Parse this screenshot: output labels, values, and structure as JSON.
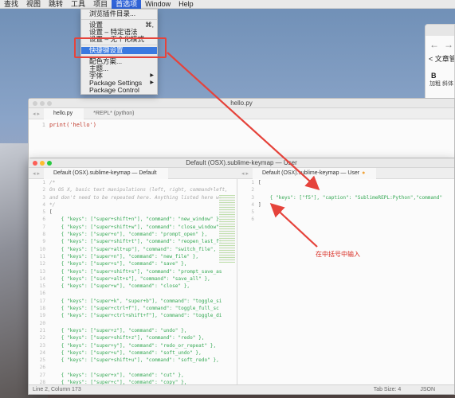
{
  "menubar": {
    "items": [
      "查找",
      "视图",
      "跳转",
      "工具",
      "项目",
      "首选项",
      "Window",
      "Help"
    ],
    "active_index": 5
  },
  "dropdown": {
    "items": [
      {
        "label": "浏览插件目录...",
        "shortcut": ""
      },
      {
        "label": "设置",
        "shortcut": "⌘,"
      },
      {
        "label": "设置 – 特定语法",
        "shortcut": ""
      },
      {
        "label": "设置 – 无个化模式",
        "shortcut": ""
      },
      {
        "label": "快捷键设置",
        "shortcut": ""
      },
      {
        "label": "配色方案...",
        "shortcut": ""
      },
      {
        "label": "主题...",
        "shortcut": ""
      },
      {
        "label": "字体",
        "shortcut": "▶"
      },
      {
        "label": "Package Settings",
        "shortcut": "▶"
      },
      {
        "label": "Package Control",
        "shortcut": ""
      }
    ],
    "highlight_index": 4
  },
  "annotation": {
    "text": "在中括号中输入",
    "color": "#d82a20"
  },
  "right_window": {
    "title": "< 文章管",
    "tool_a": "B",
    "tool_b": "加粗",
    "tool_c": "斜体"
  },
  "win1": {
    "title": "hello.py",
    "tabs": [
      "hello.py",
      "*REPL* (python)"
    ],
    "line_numbers": [
      "1"
    ],
    "code": "print('hello')"
  },
  "win2": {
    "title": "Default (OSX).sublime-keymap — User",
    "left_tab": "Default (OSX).sublime-keymap — Default",
    "right_tab": "Default (OSX).sublime-keymap — User",
    "left_gutter": [
      "1",
      "2",
      "3",
      "4",
      "5",
      "6",
      "7",
      "8",
      "9",
      "10",
      "11",
      "12",
      "13",
      "14",
      "15",
      "16",
      "17",
      "18",
      "19",
      "20",
      "21",
      "22",
      "23",
      "24",
      "25",
      "26",
      "27",
      "28"
    ],
    "left_lines": [
      "/*",
      "On OS X, basic text manipulations (left, right, command+left,",
      "and don't need to be repeated here. Anything listed here wi",
      "*/",
      "[",
      "    { \"keys\": [\"super+shift+n\"], \"command\": \"new_window\" },",
      "    { \"keys\": [\"super+shift+w\"], \"command\": \"close_window\"",
      "    { \"keys\": [\"super+o\"], \"command\": \"prompt_open\" },",
      "    { \"keys\": [\"super+shift+t\"], \"command\": \"reopen_last_fi",
      "    { \"keys\": [\"super+alt+up\"], \"command\": \"switch_file\",",
      "    { \"keys\": [\"super+n\"], \"command\": \"new_file\" },",
      "    { \"keys\": [\"super+s\"], \"command\": \"save\" },",
      "    { \"keys\": [\"super+shift+s\"], \"command\": \"prompt_save_as",
      "    { \"keys\": [\"super+alt+s\"], \"command\": \"save_all\" },",
      "    { \"keys\": [\"super+w\"], \"command\": \"close\" },",
      "",
      "    { \"keys\": [\"super+k\", \"super+b\"], \"command\": \"toggle_si",
      "    { \"keys\": [\"super+ctrl+f\"], \"command\": \"toggle_full_sc",
      "    { \"keys\": [\"super+ctrl+shift+f\"], \"command\": \"toggle_di",
      "",
      "    { \"keys\": [\"super+z\"], \"command\": \"undo\" },",
      "    { \"keys\": [\"super+shift+z\"], \"command\": \"redo\" },",
      "    { \"keys\": [\"super+y\"], \"command\": \"redo_or_repeat\" },",
      "    { \"keys\": [\"super+u\"], \"command\": \"soft_undo\" },",
      "    { \"keys\": [\"super+shift+u\"], \"command\": \"soft_redo\" },",
      "",
      "    { \"keys\": [\"super+x\"], \"command\": \"cut\" },",
      "    { \"keys\": [\"super+c\"], \"command\": \"copy\" },"
    ],
    "right_gutter": [
      "1",
      "2",
      "3",
      "4",
      "5",
      "6"
    ],
    "right_lines": [
      "[",
      "",
      "    { \"keys\": [\"f5\"], \"caption\": \"SublimeREPL:Python\",\"command\"",
      "]",
      "",
      ""
    ],
    "status_left": "Line 2, Column 173",
    "tab_size": "Tab Size: 4",
    "syntax": "JSON"
  }
}
